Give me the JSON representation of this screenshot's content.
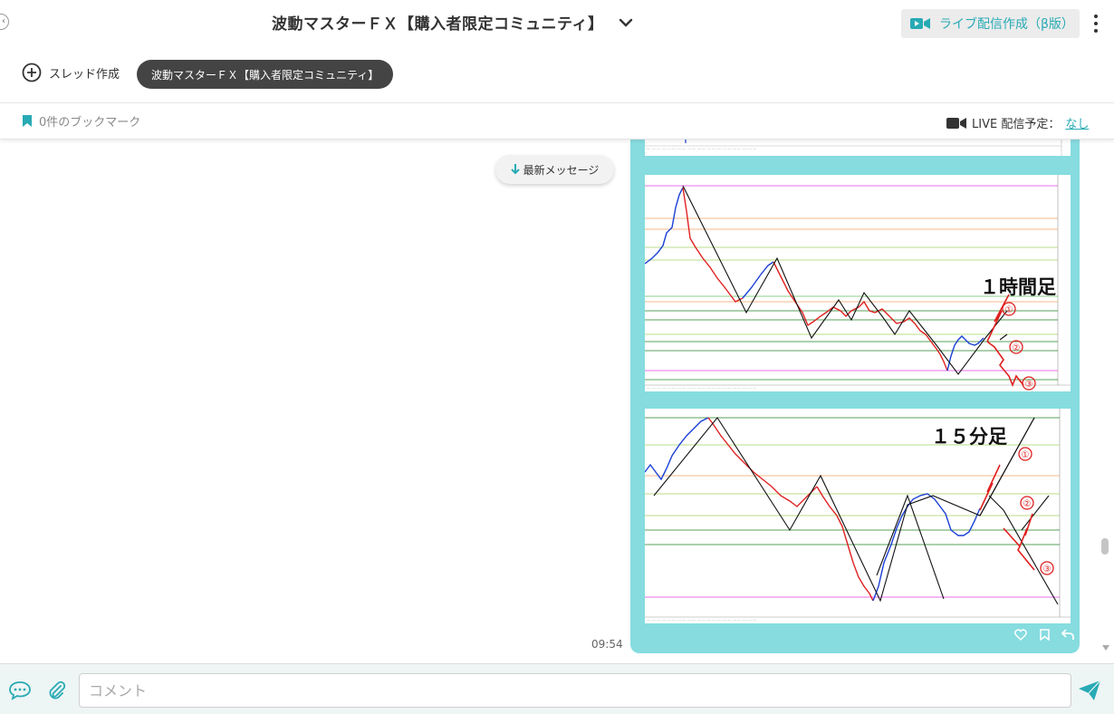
{
  "header": {
    "title": "波動マスターＦＸ【購入者限定コミュニティ】",
    "live_button_label": "ライブ配信作成（β版）",
    "thread_button_label": "スレッド作成",
    "active_tab": "波動マスターＦＸ【購入者限定コミュニティ】",
    "bookmark_label": "0件のブックマーク",
    "live_schedule_label": "LIVE 配信予定：",
    "live_schedule_value": "なし"
  },
  "chat": {
    "latest_button_label": "最新メッセージ",
    "message": {
      "time": "09:54",
      "images": [
        {
          "label": "１時間足",
          "markers": [
            "①",
            "②",
            "③"
          ]
        },
        {
          "label": "１５分足",
          "markers": [
            "①",
            "②",
            "③"
          ]
        }
      ]
    }
  },
  "composer": {
    "placeholder": "コメント"
  },
  "colors": {
    "accent": "#28aab4",
    "bubble": "#86dcdf",
    "pill": "#444444",
    "marker": "#e02020"
  },
  "icons": [
    "chevron-down-icon",
    "video-camera-icon",
    "more-vert-icon",
    "plus-circle-icon",
    "bookmark-icon",
    "arrow-down-icon",
    "heart-icon",
    "reply-icon",
    "chat-bubble-icon",
    "paperclip-icon",
    "send-icon"
  ]
}
